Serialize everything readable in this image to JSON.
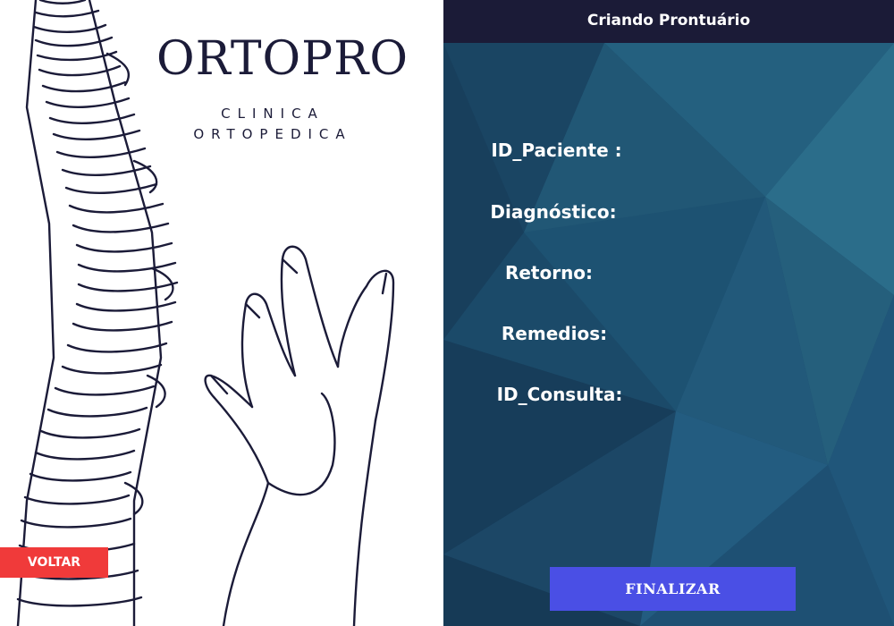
{
  "brand": {
    "name": "ORTOPRO",
    "subtitle_line1": "CLINICA",
    "subtitle_line2": "ORTOPEDICA"
  },
  "navigation": {
    "back_label": "VOLTAR"
  },
  "form": {
    "title": "Criando Prontuário",
    "fields": [
      {
        "label": "ID_Paciente :"
      },
      {
        "label": "Diagnóstico:"
      },
      {
        "label": "Retorno:"
      },
      {
        "label": "Remedios:"
      },
      {
        "label": "ID_Consulta:"
      }
    ],
    "submit_label": "FINALIZAR"
  },
  "colors": {
    "header_bg": "#1b1b37",
    "panel_bg": "#1e4d6d",
    "back_button": "#f03a3a",
    "submit_button": "#4a4fe5",
    "ink": "#1b1b38"
  },
  "icons": {
    "illustration_spine": "spine-illustration",
    "illustration_hand": "hand-illustration"
  }
}
